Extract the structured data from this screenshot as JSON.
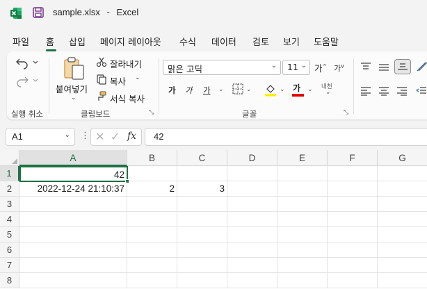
{
  "titlebar": {
    "filename": "sample.xlsx",
    "separator": "-",
    "app": "Excel"
  },
  "menu": {
    "tabs": [
      "파일",
      "홈",
      "삽입",
      "페이지 레이아웃",
      "수식",
      "데이터",
      "검토",
      "보기",
      "도움말"
    ],
    "active": "홈"
  },
  "ribbon": {
    "undo_group_label": "실행 취소",
    "clipboard": {
      "paste": "붙여넣기",
      "cut": "잘라내기",
      "copy": "복사",
      "format_painter": "서식 복사",
      "label": "클립보드"
    },
    "font": {
      "name": "맑은 고딕",
      "size": "11",
      "grow": "가",
      "shrink": "가",
      "bold": "가",
      "italic": "가",
      "underline": "가",
      "color_a": "가",
      "phonetic": "내천",
      "label": "글꼴"
    }
  },
  "formula_bar": {
    "name_box": "A1",
    "fx": "fx",
    "formula": "42"
  },
  "grid": {
    "columns": [
      "A",
      "B",
      "C",
      "D",
      "E",
      "F",
      "G"
    ],
    "rows": [
      "1",
      "2",
      "3",
      "4",
      "5",
      "6",
      "7",
      "8"
    ],
    "cells": {
      "A1": "42",
      "A2": "2022-12-24 21:10:37",
      "B2": "2",
      "C2": "3"
    },
    "active_cell": "A1"
  },
  "colors": {
    "accent": "#1e7145",
    "fill_color": "#ffef00",
    "font_color": "#e00000"
  }
}
